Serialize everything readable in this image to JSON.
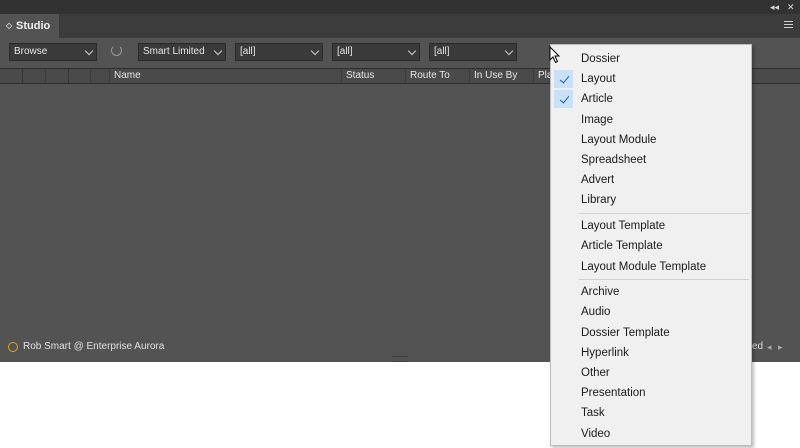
{
  "window": {
    "collapse_glyph": "◂◂",
    "close_glyph": "✕",
    "menu_icon": "hamburger-icon"
  },
  "tab": {
    "title": "Studio",
    "grip_glyph": "◇"
  },
  "toolbar": {
    "browse": "Browse",
    "publication": "Smart Limited",
    "filter1": "[all]",
    "filter2": "[all]",
    "filter3": "[all]"
  },
  "columns": [
    "Name",
    "Status",
    "Route To",
    "In Use By",
    "Pla"
  ],
  "status": {
    "user": "Rob Smart @ Enterprise Aurora",
    "right_text": "ed",
    "prev": "◂",
    "next": "▸"
  },
  "menu": {
    "groups": [
      [
        {
          "label": "Dossier",
          "checked": false
        },
        {
          "label": "Layout",
          "checked": true
        },
        {
          "label": "Article",
          "checked": true
        },
        {
          "label": "Image",
          "checked": false
        },
        {
          "label": "Layout Module",
          "checked": false
        },
        {
          "label": "Spreadsheet",
          "checked": false
        },
        {
          "label": "Advert",
          "checked": false
        },
        {
          "label": "Library",
          "checked": false
        }
      ],
      [
        {
          "label": "Layout Template",
          "checked": false
        },
        {
          "label": "Article Template",
          "checked": false
        },
        {
          "label": "Layout Module Template",
          "checked": false
        }
      ],
      [
        {
          "label": "Archive",
          "checked": false
        },
        {
          "label": "Audio",
          "checked": false
        },
        {
          "label": "Dossier Template",
          "checked": false
        },
        {
          "label": "Hyperlink",
          "checked": false
        },
        {
          "label": "Other",
          "checked": false
        },
        {
          "label": "Presentation",
          "checked": false
        },
        {
          "label": "Task",
          "checked": false
        },
        {
          "label": "Video",
          "checked": false
        }
      ]
    ]
  },
  "colors": {
    "panel": "#535353",
    "titlebar": "#323232",
    "menu_bg": "#f0f0f0",
    "check": "#1e5f9f",
    "spinner": "#e3a020"
  }
}
